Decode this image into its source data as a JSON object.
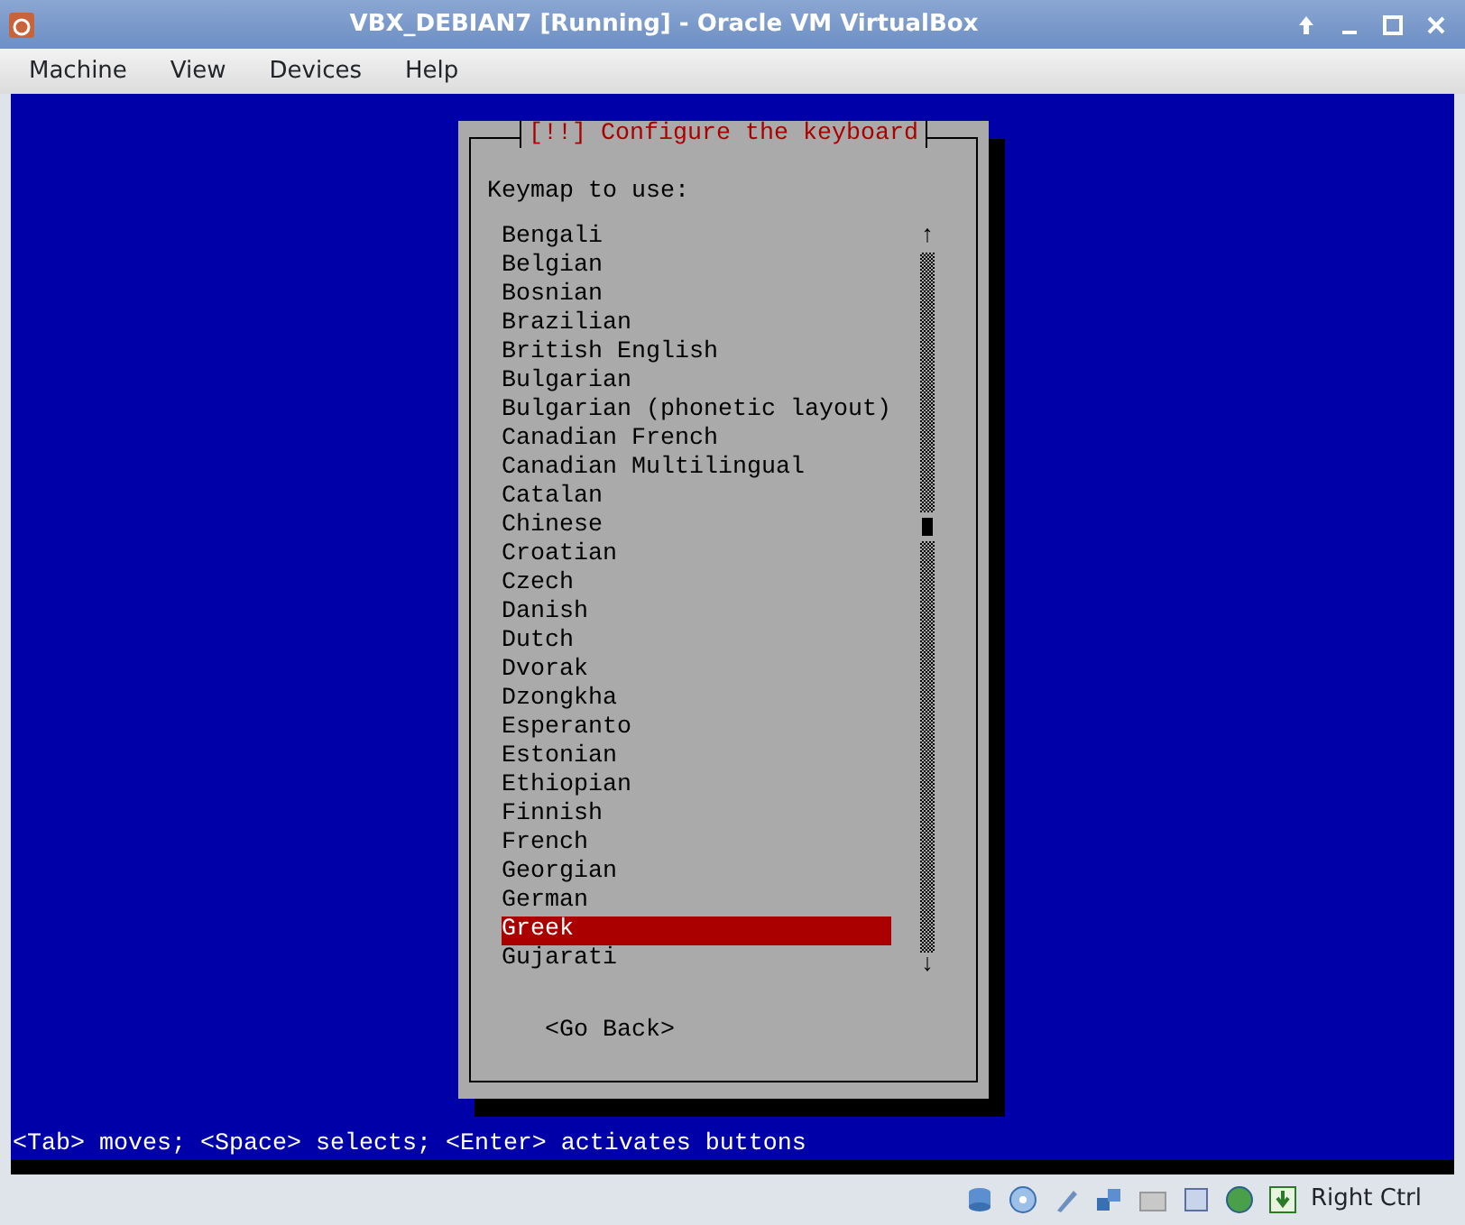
{
  "window": {
    "title": "VBX_DEBIAN7 [Running] - Oracle VM VirtualBox"
  },
  "menu": [
    "Machine",
    "View",
    "Devices",
    "Help"
  ],
  "dialog": {
    "title": "[!!] Configure the keyboard",
    "prompt": "Keymap to use:",
    "items": [
      {
        "label": "Bengali",
        "selected": false
      },
      {
        "label": "Belgian",
        "selected": false
      },
      {
        "label": "Bosnian",
        "selected": false
      },
      {
        "label": "Brazilian",
        "selected": false
      },
      {
        "label": "British English",
        "selected": false
      },
      {
        "label": "Bulgarian",
        "selected": false
      },
      {
        "label": "Bulgarian (phonetic layout)",
        "selected": false
      },
      {
        "label": "Canadian French",
        "selected": false
      },
      {
        "label": "Canadian Multilingual",
        "selected": false
      },
      {
        "label": "Catalan",
        "selected": false
      },
      {
        "label": "Chinese",
        "selected": false
      },
      {
        "label": "Croatian",
        "selected": false
      },
      {
        "label": "Czech",
        "selected": false
      },
      {
        "label": "Danish",
        "selected": false
      },
      {
        "label": "Dutch",
        "selected": false
      },
      {
        "label": "Dvorak",
        "selected": false
      },
      {
        "label": "Dzongkha",
        "selected": false
      },
      {
        "label": "Esperanto",
        "selected": false
      },
      {
        "label": "Estonian",
        "selected": false
      },
      {
        "label": "Ethiopian",
        "selected": false
      },
      {
        "label": "Finnish",
        "selected": false
      },
      {
        "label": "French",
        "selected": false
      },
      {
        "label": "Georgian",
        "selected": false
      },
      {
        "label": "German",
        "selected": false
      },
      {
        "label": "Greek",
        "selected": true
      },
      {
        "label": "Gujarati",
        "selected": false
      }
    ],
    "scroll_up": "↑",
    "scroll_down": "↓",
    "button": "<Go Back>"
  },
  "help_line": "<Tab> moves; <Space> selects; <Enter> activates buttons",
  "status_bar": {
    "host_key": "Right Ctrl"
  }
}
